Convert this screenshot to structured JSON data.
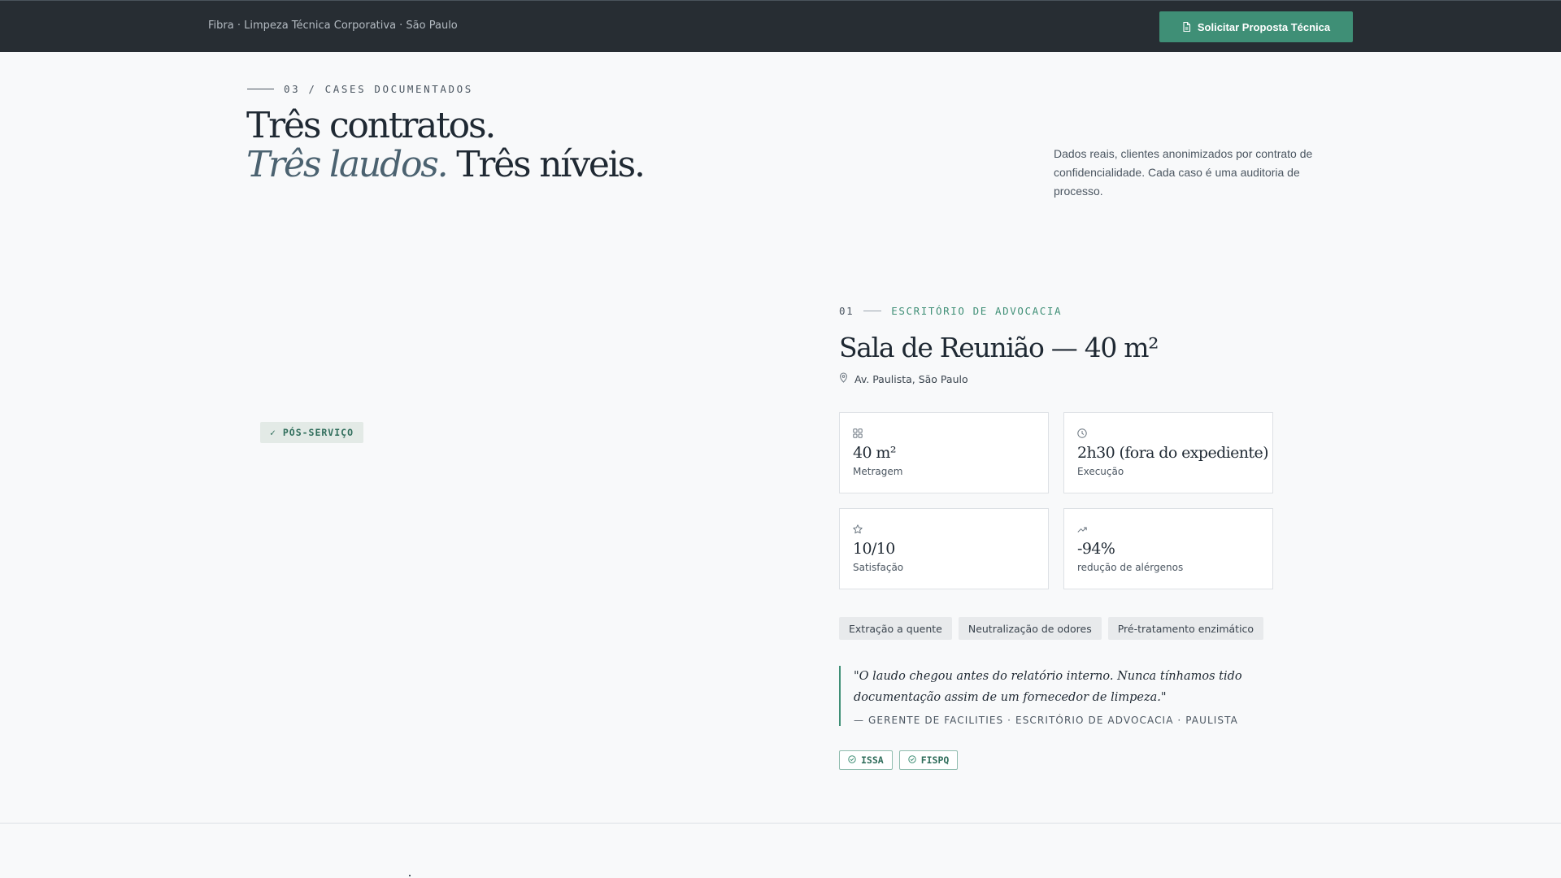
{
  "header": {
    "brand": "Fibra · Limpeza Técnica Corporativa · São Paulo",
    "cta_label": "Solicitar Proposta Técnica",
    "cta_icon": "document-icon"
  },
  "section": {
    "eyebrow": "03 / CASES DOCUMENTADOS",
    "headline_line1": "Três contratos.",
    "headline_line2_italic": "Três laudos.",
    "headline_line2_rest": " Três níveis.",
    "intro": "Dados reais, clientes anonimizados por contrato de confidencialidade. Cada caso é uma auditoria de processo."
  },
  "case": {
    "badge": "✓ PÓS-SERVIÇO",
    "number": "01",
    "category": "ESCRITÓRIO DE ADVOCACIA",
    "title": "Sala de Reunião — 40 m²",
    "location": "Av. Paulista, São Paulo",
    "stats": [
      {
        "icon": "grid-icon",
        "value": "40 m²",
        "label": "Metragem"
      },
      {
        "icon": "clock-icon",
        "value": "2h30 (fora do expediente)",
        "label": "Execução"
      },
      {
        "icon": "star-icon",
        "value": "10/10",
        "label": "Satisfação"
      },
      {
        "icon": "trend-up-icon",
        "value": "-94%",
        "label": "redução de alérgenos"
      }
    ],
    "tags": [
      "Extração a quente",
      "Neutralização de odores",
      "Pré-tratamento enzimático"
    ],
    "quote": "\"O laudo chegou antes do relatório interno. Nunca tínhamos tido documentação assim de um fornecedor de limpeza.\"",
    "quote_author": "— GERENTE DE FACILITIES · ESCRITÓRIO DE ADVOCACIA · PAULISTA",
    "certs": [
      "ISSA",
      "FISPQ"
    ]
  },
  "colors": {
    "topbar": "#272d33",
    "accent": "#3f8f76",
    "background": "#f8f9fa",
    "text": "#1f2933"
  }
}
